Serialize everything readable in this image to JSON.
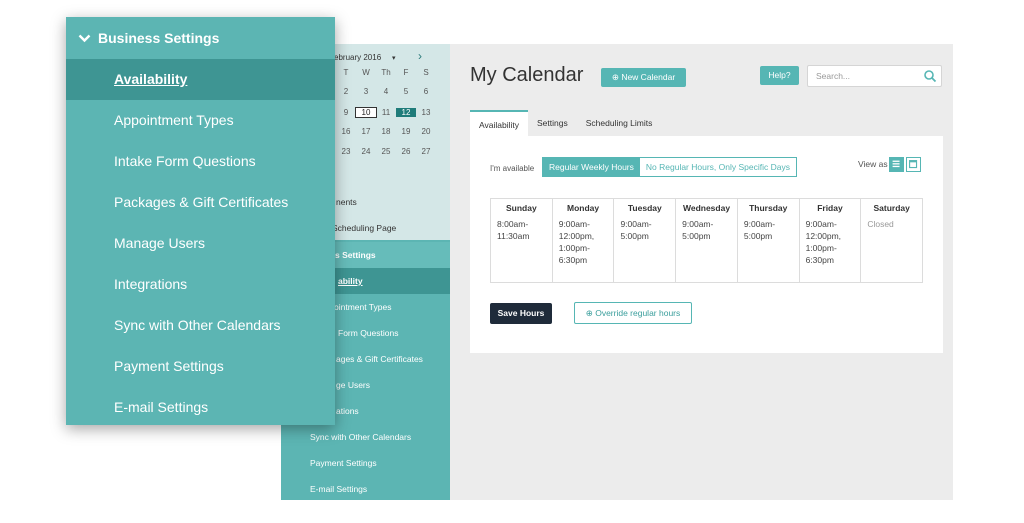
{
  "back_sidebar": {
    "month_label": "ebruary 2016",
    "weekdays": [
      "T",
      "W",
      "Th",
      "F",
      "S"
    ],
    "weeks": [
      [
        "2",
        "3",
        "4",
        "5",
        "6"
      ],
      [
        "9",
        "10",
        "11",
        "12",
        "13"
      ],
      [
        "16",
        "17",
        "18",
        "19",
        "20"
      ],
      [
        "23",
        "24",
        "25",
        "26",
        "27"
      ]
    ],
    "links": [
      "nents",
      "Scheduling Page"
    ],
    "settings_items": [
      "s Settings",
      "ability",
      "ointment Types",
      "Form Questions",
      "ages & Gift Certificates",
      "ge Users",
      "ations",
      "Sync with Other Calendars",
      "Payment Settings",
      "E-mail Settings"
    ]
  },
  "main": {
    "title": "My Calendar",
    "new_calendar": "New Calendar",
    "help": "Help?",
    "search_placeholder": "Search...",
    "tabs": [
      "Availability",
      "Settings",
      "Scheduling Limits"
    ],
    "available_label": "I'm available",
    "segment": [
      "Regular Weekly Hours",
      "No Regular Hours, Only Specific Days"
    ],
    "view_as": "View as",
    "days": [
      {
        "name": "Sunday",
        "hours": "8:00am-\n11:30am"
      },
      {
        "name": "Monday",
        "hours": "9:00am-\n12:00pm,\n1:00pm-\n6:30pm"
      },
      {
        "name": "Tuesday",
        "hours": "9:00am-\n5:00pm"
      },
      {
        "name": "Wednesday",
        "hours": "9:00am-\n5:00pm"
      },
      {
        "name": "Thursday",
        "hours": "9:00am-\n5:00pm"
      },
      {
        "name": "Friday",
        "hours": "9:00am-\n12:00pm,\n1:00pm-\n6:30pm"
      },
      {
        "name": "Saturday",
        "hours": "Closed"
      }
    ],
    "save_hours": "Save Hours",
    "override": "Override regular hours"
  },
  "overlay": {
    "header": "Business Settings",
    "items": [
      "Availability",
      "Appointment Types",
      "Intake Form Questions",
      "Packages & Gift Certificates",
      "Manage Users",
      "Integrations",
      "Sync with Other Calendars",
      "Payment Settings",
      "E-mail Settings"
    ]
  },
  "colors": {
    "accent": "#56b6b4",
    "sidebar": "#5cb5b3",
    "active": "#3e9593",
    "dark_button": "#1f2b3a"
  }
}
